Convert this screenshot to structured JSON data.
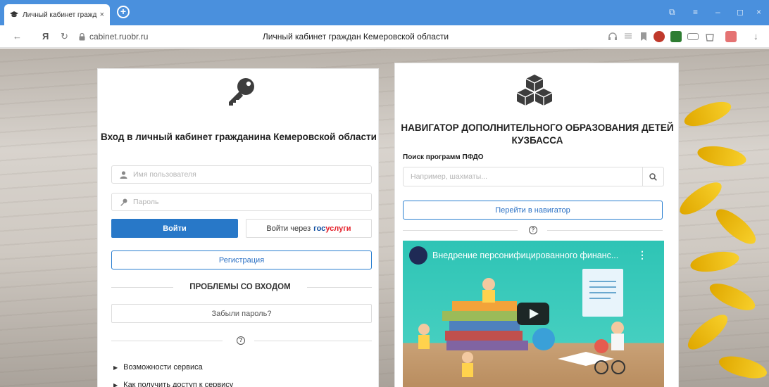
{
  "browser": {
    "tab_title": "Личный кабинет гражд",
    "tab_close": "×",
    "new_tab": "+",
    "back": "←",
    "yandex_logo": "Я",
    "reload": "↻",
    "url": "cabinet.ruobr.ru",
    "page_title": "Личный кабинет граждан Кемеровской области",
    "window_controls": [
      "⧉",
      "≡",
      "–",
      "◻",
      "×"
    ]
  },
  "login": {
    "heading": "Вход в личный кабинет гражданина Кемеровской области",
    "username_placeholder": "Имя пользователя",
    "password_placeholder": "Пароль",
    "login_button": "Войти",
    "gosuslugi_prefix": "Войти через",
    "gosuslugi_part1": "гос",
    "gosuslugi_part2": "услуги",
    "register_button": "Регистрация",
    "problems_heading": "ПРОБЛЕМЫ СО ВХОДОМ",
    "forgot_button": "Забыли пароль?",
    "help_symbol": "?",
    "accordion": [
      {
        "label": "Возможности сервиса"
      },
      {
        "label": "Как получить доступ к сервису"
      }
    ]
  },
  "navigator": {
    "heading": "НАВИГАТОР ДОПОЛНИТЕЛЬНОГО ОБРАЗОВАНИЯ ДЕТЕЙ КУЗБАССА",
    "search_label": "Поиск программ ПФДО",
    "search_placeholder": "Например, шахматы...",
    "go_button": "Перейти в навигатор",
    "help_symbol": "?",
    "video_title": "Внедрение персонифицированного финанс...",
    "video_menu": "⋮"
  },
  "colors": {
    "tabbar": "#4a90dd",
    "primary": "#2878c8",
    "gos_blue": "#0b4c9f",
    "gos_red": "#e4212b"
  }
}
